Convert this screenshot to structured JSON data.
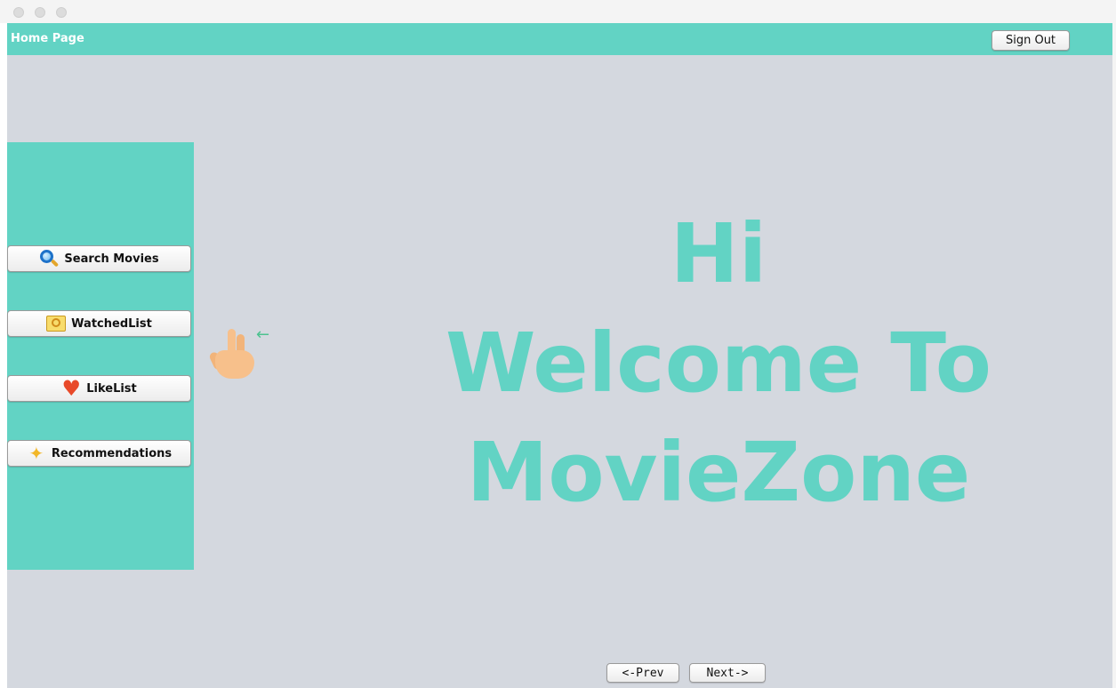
{
  "window": {
    "title_bar_buttons": [
      "close",
      "minimize",
      "zoom"
    ]
  },
  "header": {
    "title": "Home Page",
    "sign_out_label": "Sign Out"
  },
  "sidebar": {
    "items": [
      {
        "label": "Search Movies",
        "icon": "magnifier-icon"
      },
      {
        "label": "WatchedList",
        "icon": "film-reel-icon"
      },
      {
        "label": "LikeList",
        "icon": "heart-icon"
      },
      {
        "label": "Recommendations",
        "icon": "sparkle-thumb-icon"
      }
    ]
  },
  "main": {
    "pointer_icon": "pointing-hand-icon",
    "pointer_arrow": "←",
    "welcome_lines": [
      "Hi",
      "Welcome To",
      "MovieZone"
    ]
  },
  "pagination": {
    "prev_label": "<-Prev",
    "next_label": "Next->"
  },
  "colors": {
    "accent": "#62d3c4",
    "background": "#d4d8df",
    "heart": "#e84a2a"
  }
}
